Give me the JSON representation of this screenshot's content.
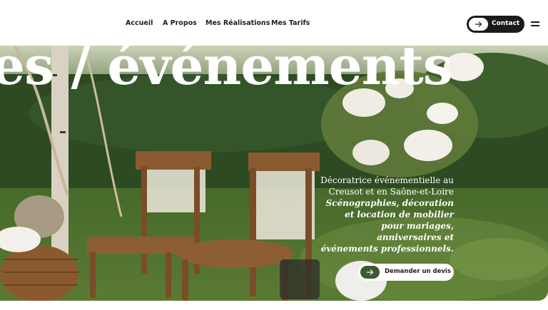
{
  "nav": {
    "items": [
      {
        "label": "Accueil"
      },
      {
        "label": "A Propos"
      },
      {
        "label": "Mes Réalisations"
      },
      {
        "label": "Mes Tarifs"
      }
    ],
    "contact_label": "Contact"
  },
  "hero": {
    "title": "es / événements",
    "intro": "Décoratrice événementielle au Creusot et en Saône-et-Loire",
    "services": "Scénographies, décoration et location de mobilier pour mariages, anniversaires et événements professionnels.",
    "cta_label": "Demander un devis"
  },
  "colors": {
    "accent_green": "#3c5a32",
    "button_dark": "#1b1b1b"
  },
  "icons": [
    "arrow-right-icon",
    "hamburger-menu-icon"
  ]
}
